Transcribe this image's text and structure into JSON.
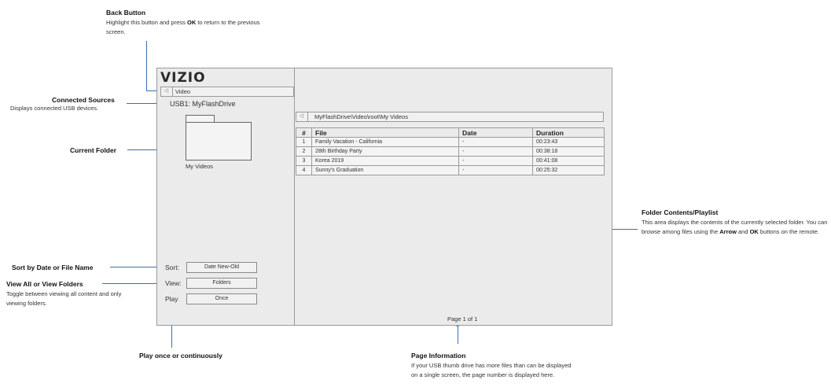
{
  "callouts": {
    "back_button": {
      "title": "Back Button",
      "desc_pre": "Highlight this button and press ",
      "desc_key": "OK",
      "desc_post": " to return to the previous screen."
    },
    "connected_sources": {
      "title": "Connected Sources",
      "desc": "Displays connected USB devices."
    },
    "current_folder": {
      "title": "Current Folder"
    },
    "sort": {
      "title": "Sort by Date or File Name"
    },
    "view": {
      "title": "View All or View Folders",
      "desc": "Toggle between viewing all content and only viewing folders."
    },
    "play": {
      "title": "Play once or continuously"
    },
    "folder_contents": {
      "title": "Folder Contents/Playlist",
      "desc_pre": "This area displays the contents of the currently selected folder. You can browse among files using the ",
      "desc_key1": "Arrow",
      "desc_mid": " and ",
      "desc_key2": "OK",
      "desc_post": " buttons on the remote."
    },
    "page_info": {
      "title": "Page Information",
      "desc": "If your USB thumb drive has more files than can be displayed on a single screen, the page number is displayed here."
    }
  },
  "screen": {
    "logo": "VIZIO",
    "back_label": "Video",
    "back_glyph": "◁",
    "source": "USB1: MyFlashDrive",
    "folder_name": "My Videos",
    "sort_label": "Sort:",
    "sort_value": "Date New-Old",
    "view_label": "View:",
    "view_value": "Folders",
    "play_label": "Play",
    "play_value": "Once",
    "path": "MyFlashDrive\\Video\\root\\My Videos",
    "page_info": "Page 1 of 1"
  },
  "table": {
    "headers": {
      "num": "#",
      "file": "File",
      "date": "Date",
      "duration": "Duration"
    },
    "rows": [
      {
        "num": "1",
        "file": "Family Vacation - California",
        "date": "-",
        "duration": "00:23:43"
      },
      {
        "num": "2",
        "file": "28th Birthday Party",
        "date": "-",
        "duration": "00:38:18"
      },
      {
        "num": "3",
        "file": "Korea 2019",
        "date": "-",
        "duration": "00:41:08"
      },
      {
        "num": "4",
        "file": "Sunny's Graduation",
        "date": "-",
        "duration": "00:25:32"
      }
    ]
  },
  "colors": {
    "leader": "#3a6fb5",
    "screen_bg": "#ebebeb",
    "border": "#9a9a9a"
  }
}
